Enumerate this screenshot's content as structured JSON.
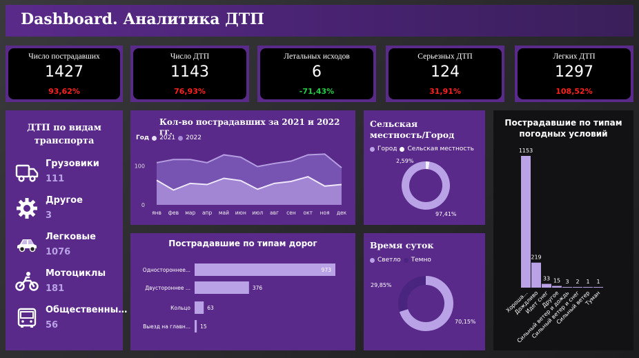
{
  "header": {
    "title": "Dashboard. Аналитика ДТП"
  },
  "kpis": [
    {
      "label": "Число пострадавших",
      "value": "1427",
      "pct": "93,62%",
      "trend": "red"
    },
    {
      "label": "Число ДТП",
      "value": "1143",
      "pct": "76,93%",
      "trend": "red"
    },
    {
      "label": "Летальных исходов",
      "value": "6",
      "pct": "-71,43%",
      "trend": "green"
    },
    {
      "label": "Серьезных ДТП",
      "value": "124",
      "pct": "31,91%",
      "trend": "red"
    },
    {
      "label": "Легких ДТП",
      "value": "1297",
      "pct": "108,52%",
      "trend": "red"
    }
  ],
  "vehicles": {
    "title": "ДТП по видам транспорта",
    "items": [
      {
        "name": "Грузовики",
        "value": "111",
        "icon": "truck-icon"
      },
      {
        "name": "Другое",
        "value": "3",
        "icon": "gear-icon"
      },
      {
        "name": "Легковые",
        "value": "1076",
        "icon": "car-icon"
      },
      {
        "name": "Мотоциклы",
        "value": "181",
        "icon": "motorcycle-icon"
      },
      {
        "name": "Общественный...",
        "value": "56",
        "icon": "bus-icon"
      }
    ]
  },
  "colors": {
    "panel": "#5a2a8a",
    "light": "#b9a2e6",
    "mid": "#8a66c8",
    "dark": "#4a2580",
    "red": "#ff2020",
    "green": "#22cc44"
  },
  "chart_data": [
    {
      "type": "area",
      "title": "Кол-во пострадавших за 2021 и 2022 гг.",
      "legend_title": "Год",
      "categories": [
        "янв",
        "фев",
        "мар",
        "апр",
        "май",
        "июн",
        "июл",
        "авг",
        "сен",
        "окт",
        "ноя",
        "дек"
      ],
      "y_ticks": [
        "100",
        "0"
      ],
      "ylim": [
        0,
        150
      ],
      "series": [
        {
          "name": "2021",
          "values": [
            63,
            38,
            55,
            52,
            68,
            62,
            40,
            55,
            60,
            72,
            48,
            52
          ]
        },
        {
          "name": "2022",
          "values": [
            108,
            116,
            116,
            108,
            128,
            122,
            98,
            106,
            112,
            128,
            130,
            95
          ]
        }
      ]
    },
    {
      "type": "pie",
      "title": "Сельская местность/Город",
      "labels": [
        "Город",
        "Сельская местность"
      ],
      "values": [
        97.41,
        2.59
      ],
      "display": [
        "97,41%",
        "2,59%"
      ]
    },
    {
      "type": "bar",
      "title": "Пострадавшие по типам дорог",
      "categories": [
        "Одностороннее...",
        "Двустороннее ...",
        "Кольцо",
        "Выезд на главн..."
      ],
      "values": [
        973,
        376,
        63,
        15
      ]
    },
    {
      "type": "pie",
      "title": "Время суток",
      "labels": [
        "Светло",
        "Темно"
      ],
      "values": [
        70.15,
        29.85
      ],
      "display": [
        "70,15%",
        "29,85%"
      ]
    },
    {
      "type": "bar",
      "title": "Пострадавшие по типам погодных условий",
      "categories": [
        "Хороша...",
        "Дождливо",
        "Идет снег",
        "Другое",
        "Сильный ветер и дождь",
        "Сильный ветер и снег",
        "Сильный ветер",
        "Туман"
      ],
      "values": [
        1153,
        219,
        33,
        15,
        3,
        2,
        1,
        1
      ]
    }
  ]
}
